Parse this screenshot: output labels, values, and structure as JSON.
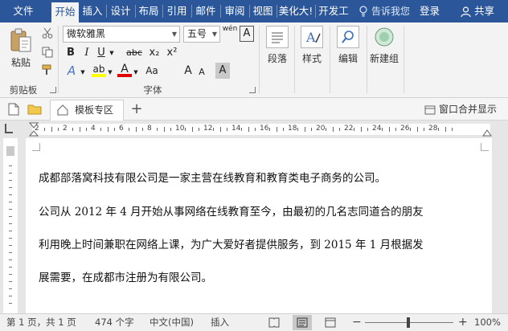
{
  "tabs": [
    {
      "label": "文件",
      "active": false
    },
    {
      "label": "开始",
      "active": true
    },
    {
      "label": "插入",
      "active": false
    },
    {
      "label": "设计",
      "active": false
    },
    {
      "label": "布局",
      "active": false
    },
    {
      "label": "引用",
      "active": false
    },
    {
      "label": "邮件",
      "active": false
    },
    {
      "label": "审阅",
      "active": false
    },
    {
      "label": "视图",
      "active": false
    },
    {
      "label": "美化大!",
      "active": false
    },
    {
      "label": "开发工",
      "active": false
    }
  ],
  "tell_me": "告诉我您",
  "login": "登录",
  "share": "共享",
  "ribbon": {
    "clipboard": {
      "paste": "粘贴",
      "group": "剪贴板"
    },
    "font": {
      "font_name": "微软雅黑",
      "font_size": "五号",
      "pinyin": "wén",
      "border_char": "A",
      "bold": "B",
      "italic": "I",
      "underline": "U",
      "strike": "abc",
      "subscript": "x₂",
      "superscript": "x²",
      "effects": "A",
      "highlight": "ab",
      "font_color": "A",
      "aa": "Aa",
      "grow": "A",
      "shrink": "A",
      "char_shade": "A",
      "group": "字体"
    },
    "paragraph": "段落",
    "styles": "样式",
    "editing": "编辑",
    "new_group": "新建组"
  },
  "doc_tabs": {
    "template": "模板专区",
    "add": "+",
    "window_merge": "窗口合并显示"
  },
  "ruler_numbers": [
    "2",
    "2",
    "4",
    "6",
    "8",
    "10",
    "12",
    "14",
    "16",
    "18",
    "20",
    "22",
    "24",
    "26",
    "28"
  ],
  "document": {
    "paragraphs": [
      "成都部落窝科技有限公司是一家主营在线教育和教育类电子商务的公司。",
      "公司从 2012 年 4 月开始从事网络在线教育至今，由最初的几名志同道合的朋友",
      "利用晚上时间兼职在网络上课，为广大爱好者提供服务，到 2015 年 1 月根据发",
      "展需要，在成都市注册为有限公司。"
    ]
  },
  "status": {
    "page": "第 1 页，共 1 页",
    "words": "474 个字",
    "language": "中文(中国)",
    "mode": "插入",
    "zoom": "100%",
    "minus": "−",
    "plus": "+"
  },
  "colors": {
    "brand": "#2b579a",
    "highlight": "#ffff00",
    "font_color": "#e00000"
  }
}
